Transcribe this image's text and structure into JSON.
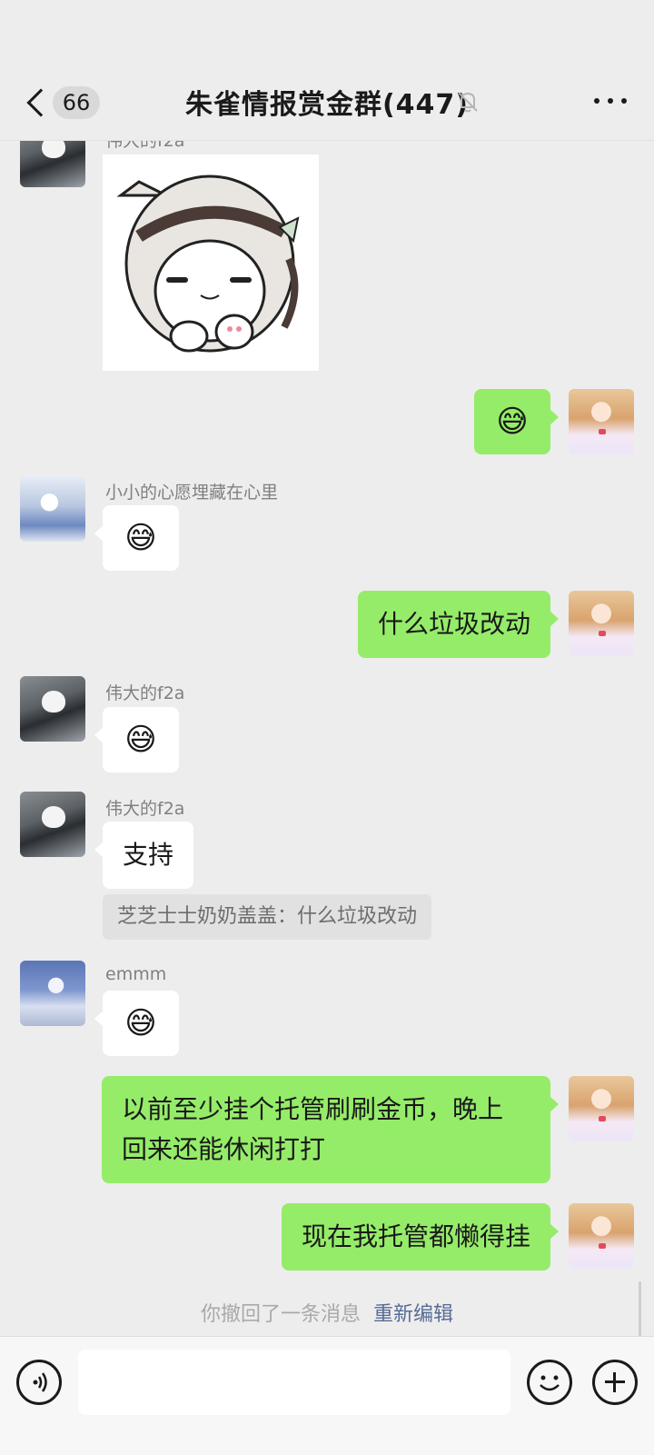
{
  "header": {
    "back_label": "66",
    "title": "朱雀情报赏金群(447)",
    "mute_icon": "bell-off-icon",
    "more_icon": "more-dots-icon"
  },
  "messages": {
    "m1_sender": "伟大的f2a",
    "m1_sticker": "anime-girl-sticker",
    "m2_emoji": "😅",
    "m3_sender": "小小的心愿埋藏在心里",
    "m3_emoji": "😅",
    "m4_text": "什么垃圾改动",
    "m5_sender": "伟大的f2a",
    "m5_emoji": "😅",
    "m6_sender": "伟大的f2a",
    "m6_text": "支持",
    "m6_quote": "芝芝士士奶奶盖盖：什么垃圾改动",
    "m7_sender": "emmm",
    "m7_emoji": "😅",
    "m8_line1": "以前至少挂个托管刷刷金币，晚上",
    "m8_line2": "回来还能休闲打打",
    "m9_text": "现在我托管都懒得挂"
  },
  "recall": {
    "text": "你撤回了一条消息",
    "edit_label": "重新编辑"
  },
  "input_bar": {
    "voice_icon": "voice-icon",
    "emoji_icon": "emoji-icon",
    "plus_icon": "plus-icon"
  },
  "colors": {
    "background": "#ededed",
    "outgoing_bubble": "#95ec69",
    "incoming_bubble": "#ffffff",
    "link": "#576b95"
  }
}
